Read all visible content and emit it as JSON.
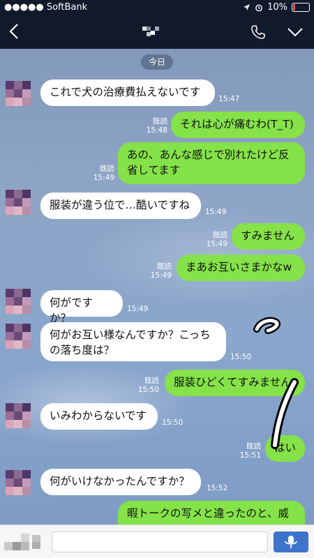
{
  "status": {
    "carrier": "●●●●● SoftBank",
    "battery": "10%"
  },
  "header": {
    "title": "",
    "icons": [
      "back-chevron-icon",
      "phone-icon",
      "chevron-down-icon"
    ]
  },
  "date_label": "今日",
  "read_label": "既読",
  "messages": [
    {
      "dir": "in",
      "text": "これで犬の治療費払えないです",
      "time": "15:47"
    },
    {
      "dir": "out",
      "text": "それは心が痛むわ(T_T)",
      "time": "15:48",
      "read": "既読"
    },
    {
      "dir": "out",
      "text": "あの、あんな感じで別れたけど反省してます",
      "time": "15:49",
      "read": "既読"
    },
    {
      "dir": "in",
      "text": "服装が違う位で…酷いですね",
      "time": "15:49"
    },
    {
      "dir": "out",
      "text": "すみません",
      "time": "15:49",
      "read": "既読"
    },
    {
      "dir": "out",
      "text": "まあお互いさまかなw",
      "time": "15:49",
      "read": "既読"
    },
    {
      "dir": "in",
      "text": "何がですか？",
      "time": "15:49"
    },
    {
      "dir": "in",
      "text": "何がお互い様なんですか？こっちの落ち度は？",
      "time": "15:50"
    },
    {
      "dir": "out",
      "text": "服装ひどくてすみません",
      "time": "15:50",
      "read": "既読"
    },
    {
      "dir": "in",
      "text": "いみわからないです",
      "time": "15:50"
    },
    {
      "dir": "out",
      "text": "はい",
      "time": "15:51",
      "read": "既読"
    },
    {
      "dir": "in",
      "text": "何がいけなかったんですか？",
      "time": "15:52"
    },
    {
      "dir": "out",
      "text": "暇トークの写メと違ったのと、威",
      "time": "",
      "read": ""
    }
  ],
  "input": {
    "placeholder": ""
  },
  "colors": {
    "header_bg": "#111a2b",
    "outgoing_bubble": "#85e249",
    "incoming_bubble": "#ffffff",
    "mic_button": "#3d73c9"
  }
}
